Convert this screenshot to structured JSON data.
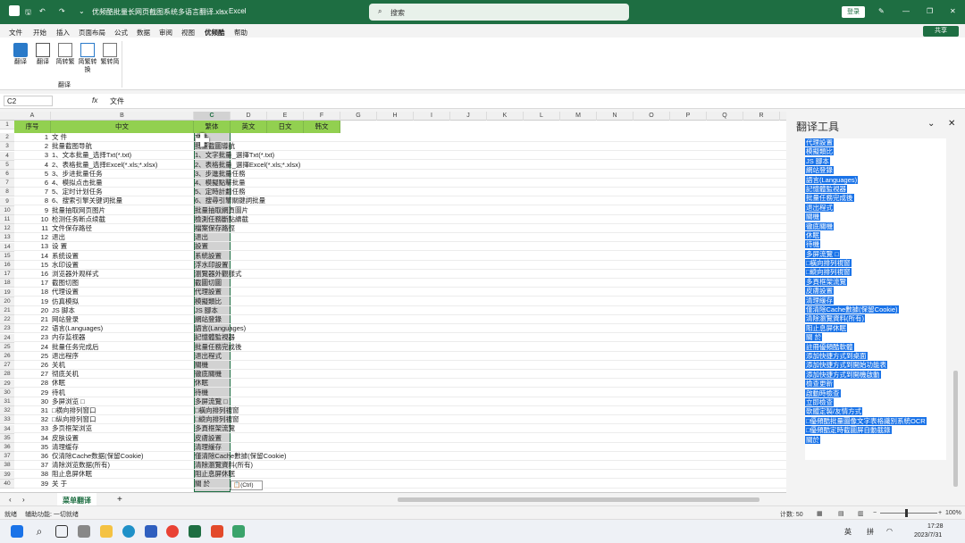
{
  "titlebar": {
    "filename": "优频酷批量长网页截图系统多语言翻译.xlsx",
    "dash": "-",
    "app": "Excel",
    "search_placeholder": "搜索",
    "login": "登录"
  },
  "menu": [
    "文件",
    "开始",
    "插入",
    "页面布局",
    "公式",
    "数据",
    "审阅",
    "视图",
    "优频酷",
    "帮助"
  ],
  "share": "共享",
  "ribbon": {
    "buttons": [
      "翻译",
      "翻译",
      "简转繁",
      "简繁转换",
      "繁转简"
    ],
    "group": "翻译"
  },
  "formula": {
    "namebox": "C2",
    "fx": "fx",
    "content": "文件"
  },
  "columns": [
    "A",
    "B",
    "C",
    "D",
    "E",
    "F",
    "G",
    "H",
    "I",
    "J",
    "K",
    "L",
    "M",
    "N",
    "O",
    "P",
    "Q",
    "R"
  ],
  "headers": [
    "序号",
    "中文",
    "繁体",
    "英文",
    "日文",
    "韩文"
  ],
  "rows": [
    [
      "1",
      "文 件",
      "文件"
    ],
    [
      "2",
      "批量截图导航",
      "批量截圖導航"
    ],
    [
      "3",
      "1、文本批量_选择Txt(*.txt)",
      "1、文字批量_選擇Txt(*.txt)"
    ],
    [
      "4",
      "2、表格批量_选择Excel(*.xls;*.xlsx)",
      "2、表格批量_選擇Excel(*.xls;*.xlsx)"
    ],
    [
      "5",
      "3、步进批量任务",
      "3、步進批量任務"
    ],
    [
      "6",
      "4、模拟点击批量",
      "4、模擬點擊批量"
    ],
    [
      "7",
      "5、定时计划任务",
      "5、定時計劃任務"
    ],
    [
      "8",
      "6、搜索引擎关键词批量",
      "6、搜尋引擎關鍵詞批量"
    ],
    [
      "9",
      "批量抽取网页图片",
      "批量抽取網頁圖片"
    ],
    [
      "10",
      "检测任务断点续截",
      "檢測任務斷點續截"
    ],
    [
      "11",
      "文件保存路径",
      "檔案保存路徑"
    ],
    [
      "12",
      "退出",
      "退出"
    ],
    [
      "13",
      "设 置",
      "設置"
    ],
    [
      "14",
      "系统设置",
      "系統設置"
    ],
    [
      "15",
      "水印设置",
      "浮水印設置"
    ],
    [
      "16",
      "浏览器外观样式",
      "瀏覽器外觀樣式"
    ],
    [
      "17",
      "截图切图",
      "截圖切圖"
    ],
    [
      "18",
      "代理设置",
      "代理設置"
    ],
    [
      "19",
      "仿真模拟",
      "模擬類比"
    ],
    [
      "20",
      "JS 脚本",
      "JS 腳本"
    ],
    [
      "21",
      "网站登录",
      "網站登錄"
    ],
    [
      "22",
      "语言(Languages)",
      "語言(Languages)"
    ],
    [
      "23",
      "内存监视器",
      "記憶體監視器"
    ],
    [
      "24",
      "批量任务完成后",
      "批量任務完成後"
    ],
    [
      "25",
      "退出程序",
      "退出程式"
    ],
    [
      "26",
      "关机",
      "關機"
    ],
    [
      "27",
      "彻底关机",
      "徹底關機"
    ],
    [
      "28",
      "休眠",
      "休眠"
    ],
    [
      "29",
      "待机",
      "待機"
    ],
    [
      "30",
      "多屏浏览 □",
      "多屏流覽 □"
    ],
    [
      "31",
      "□横向排列窗口",
      "□橫向排列視窗"
    ],
    [
      "32",
      "□纵向排列窗口",
      "□縱向排列視窗"
    ],
    [
      "33",
      "多页框架浏览",
      "多頁框架流覽"
    ],
    [
      "34",
      "皮肤设置",
      "皮膚設置"
    ],
    [
      "35",
      "清理缓存",
      "清理緩存"
    ],
    [
      "36",
      "仅清除Cache数据(保留Cookie)",
      "僅清除Cache數據(保留Cookie)"
    ],
    [
      "37",
      "清除浏览数据(所有)",
      "清除瀏覽資料(所有)"
    ],
    [
      "38",
      "阻止息屏休眠",
      "阻止息屏休眠"
    ],
    [
      "39",
      "关 于",
      "關 於"
    ]
  ],
  "paste_tag": "(Ctrl)",
  "pane": {
    "title": "翻译工具",
    "items": [
      "代理設置",
      "模擬類比",
      "JS 腳本",
      "網站登錄",
      "語言(Languages)",
      "記憶體監視器",
      "批量任務完成後",
      "退出程式",
      "關機",
      "徹底關機",
      "休眠",
      "待機",
      "多屏流覽 □",
      "□橫向排列視窗",
      "□縱向排列視窗",
      "多頁框架流覽",
      "皮膚設置",
      "清理緩存",
      "僅清除Cache數據(保留Cookie)",
      "清除瀏覽資料(所有)",
      "阻止息屏休眠",
      "關 於",
      "註冊優頻酷軟體",
      "添加快捷方式到桌面",
      "添加快捷方式到開始功能表",
      "添加快捷方式到開機啟動",
      "檢查更新",
      "啟動時檢查",
      "立即檢查",
      "軟體定製/友情方式",
      "□優頻酷批量圖像文字表格識別系統OCR",
      "□優頻酷定時截圖屏自動截錄",
      "關於"
    ]
  },
  "sheet": {
    "tab": "菜单翻译",
    "add": "+"
  },
  "status": {
    "ready": "就绪",
    "accessibility": "辅助功能: 一切就绪",
    "count": "计数: 50",
    "zoom": "100%"
  },
  "taskbar": {
    "lang": "英",
    "ime": "拼",
    "time": "17:28",
    "date": "2023/7/31"
  }
}
